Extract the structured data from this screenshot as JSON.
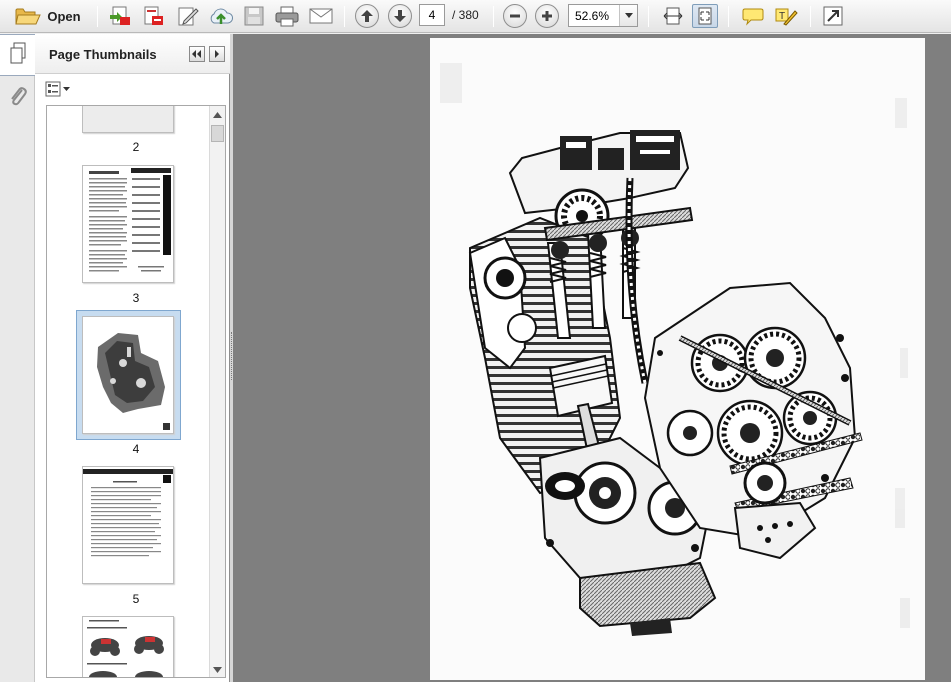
{
  "toolbar": {
    "open_label": "Open",
    "current_page": "4",
    "page_total": "/  380",
    "zoom": "52.6%",
    "icons": [
      "folder-open-icon",
      "create-pdf-icon",
      "export-pdf-icon",
      "edit-icon",
      "upload-icon",
      "save-icon",
      "print-icon",
      "email-icon",
      "previous-page-icon",
      "next-page-icon",
      "zoom-out-icon",
      "zoom-in-icon",
      "zoom-dropdown-icon",
      "fit-width-icon",
      "fit-page-icon",
      "comment-icon",
      "highlight-icon",
      "expand-icon"
    ]
  },
  "nav_rail": {
    "icons": [
      "page-thumbnails-icon",
      "attachments-icon"
    ]
  },
  "thumbnail_panel": {
    "title": "Page Thumbnails",
    "thumbnails": [
      {
        "label": "2"
      },
      {
        "label": "3"
      },
      {
        "label": "4",
        "selected": true
      },
      {
        "label": "5"
      },
      {
        "label": ""
      }
    ]
  },
  "document": {
    "content": "engine-cutaway-illustration"
  },
  "colors": {
    "doc_background": "#7f7f7f",
    "selection": "#c7dcf0",
    "selection_border": "#7fa7cf"
  }
}
